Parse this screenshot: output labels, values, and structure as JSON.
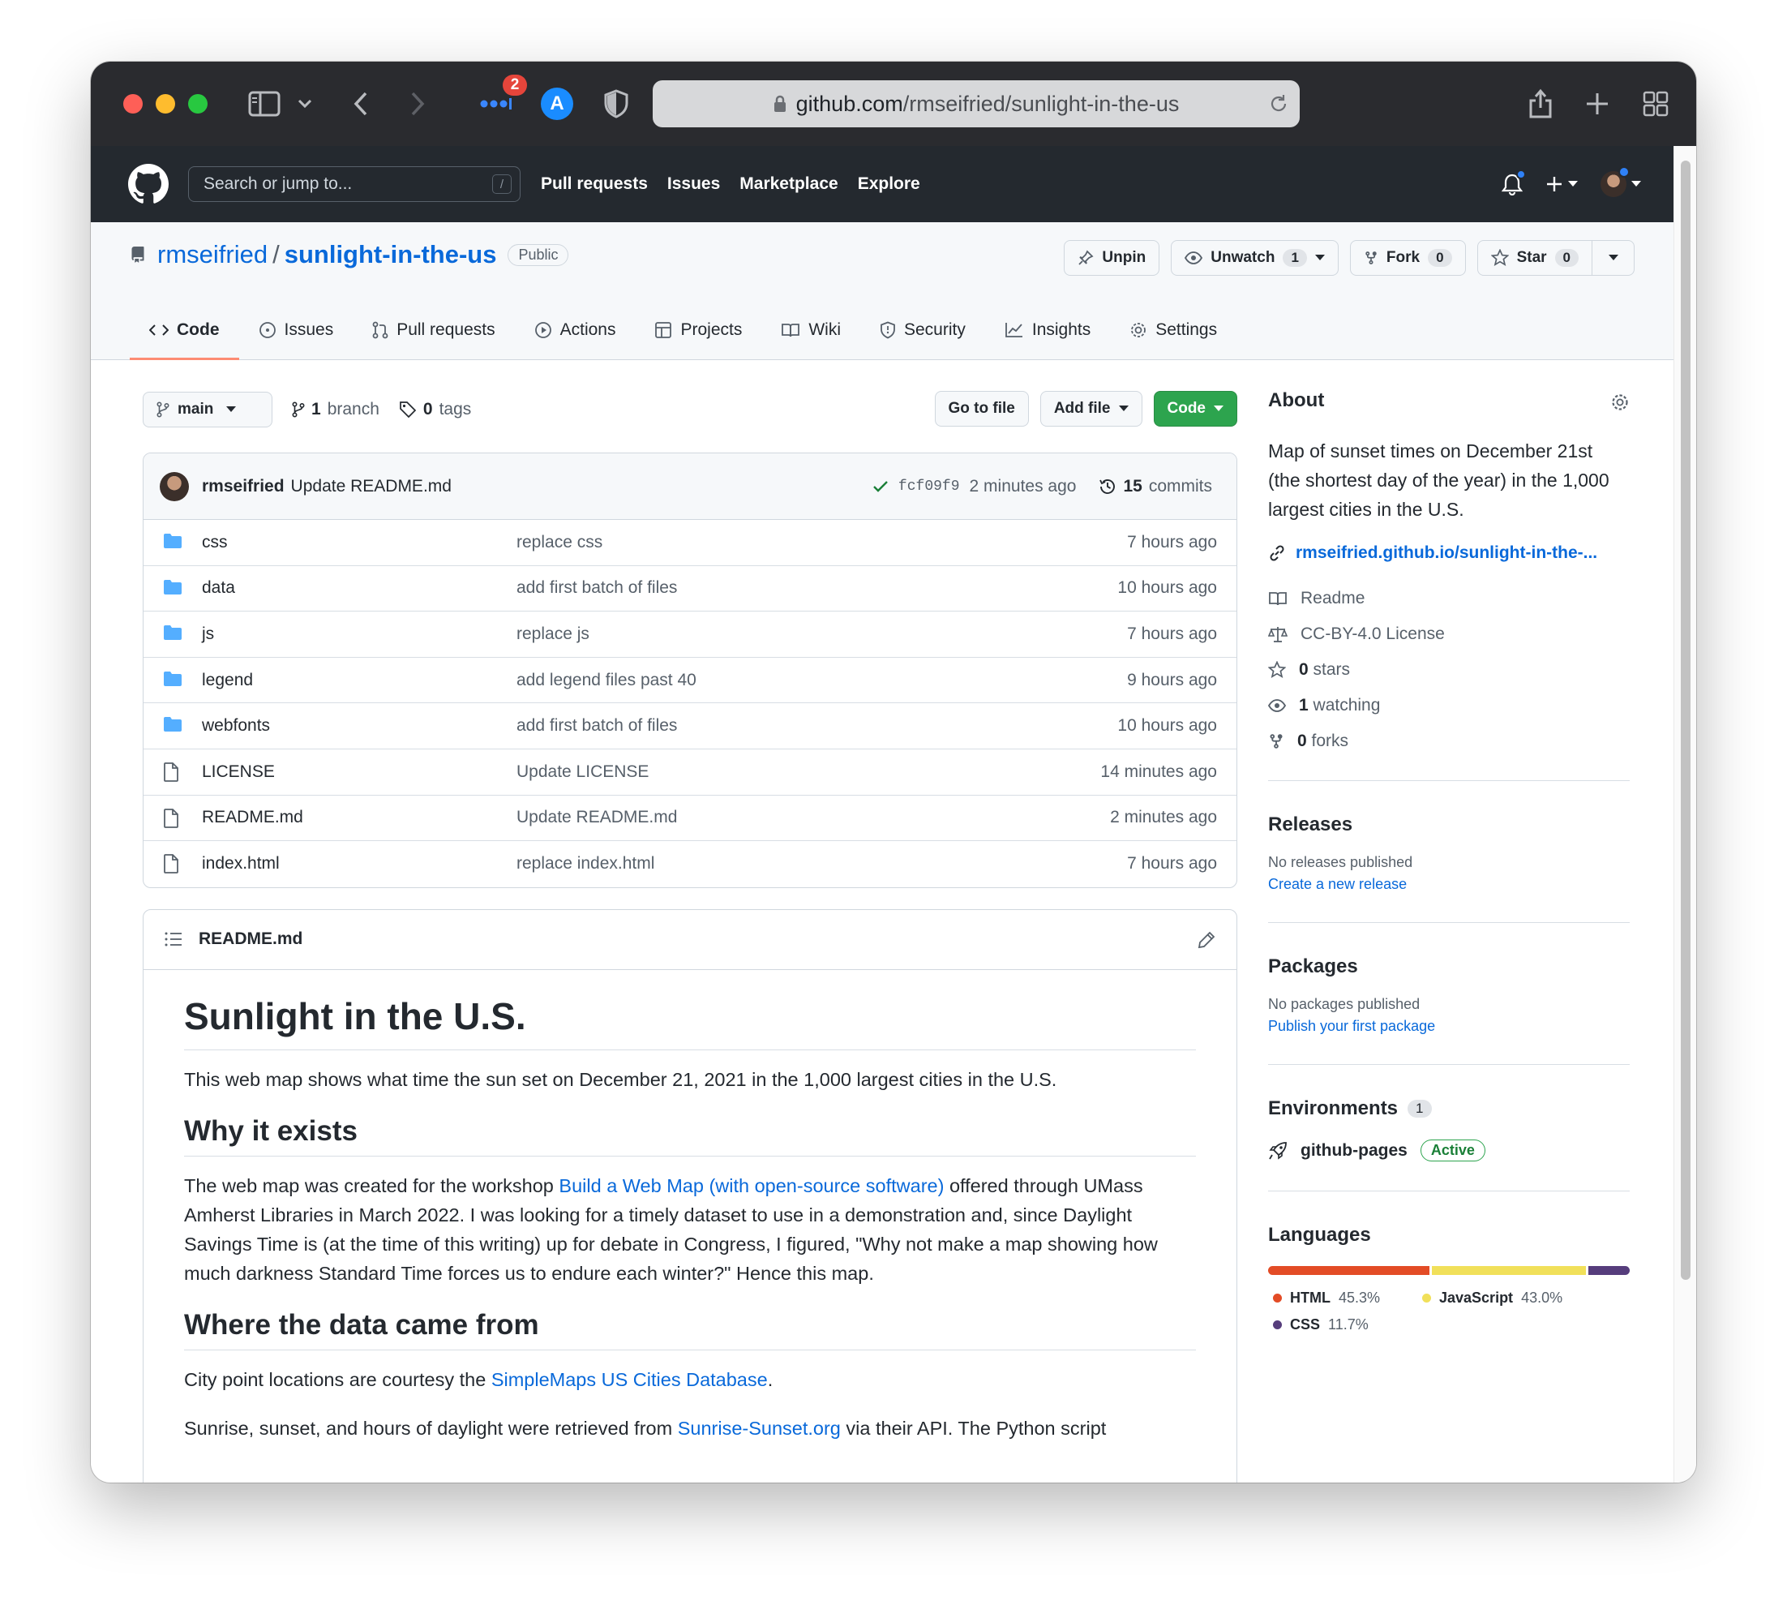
{
  "browser": {
    "url_host": "github.com",
    "url_path": "/rmseifried/sunlight-in-the-us",
    "notification_count": "2",
    "extension_letter": "A"
  },
  "gh_header": {
    "search_placeholder": "Search or jump to...",
    "search_shortcut": "/",
    "nav": [
      "Pull requests",
      "Issues",
      "Marketplace",
      "Explore"
    ]
  },
  "repo": {
    "owner": "rmseifried",
    "separator": "/",
    "name": "sunlight-in-the-us",
    "visibility": "Public",
    "actions": {
      "unpin": "Unpin",
      "unwatch": "Unwatch",
      "watch_count": "1",
      "fork": "Fork",
      "fork_count": "0",
      "star": "Star",
      "star_count": "0"
    },
    "tabs": [
      "Code",
      "Issues",
      "Pull requests",
      "Actions",
      "Projects",
      "Wiki",
      "Security",
      "Insights",
      "Settings"
    ]
  },
  "toolbar": {
    "branch": "main",
    "branch_count": "1",
    "branch_label": "branch",
    "tag_count": "0",
    "tag_label": "tags",
    "go_to_file": "Go to file",
    "add_file": "Add file",
    "code": "Code"
  },
  "commit": {
    "author": "rmseifried",
    "message": "Update README.md",
    "sha": "fcf09f9",
    "time": "2 minutes ago",
    "count": "15",
    "count_label": "commits"
  },
  "files": [
    {
      "name": "css",
      "type": "dir",
      "message": "replace css",
      "age": "7 hours ago"
    },
    {
      "name": "data",
      "type": "dir",
      "message": "add first batch of files",
      "age": "10 hours ago"
    },
    {
      "name": "js",
      "type": "dir",
      "message": "replace js",
      "age": "7 hours ago"
    },
    {
      "name": "legend",
      "type": "dir",
      "message": "add legend files past 40",
      "age": "9 hours ago"
    },
    {
      "name": "webfonts",
      "type": "dir",
      "message": "add first batch of files",
      "age": "10 hours ago"
    },
    {
      "name": "LICENSE",
      "type": "file",
      "message": "Update LICENSE",
      "age": "14 minutes ago"
    },
    {
      "name": "README.md",
      "type": "file",
      "message": "Update README.md",
      "age": "2 minutes ago"
    },
    {
      "name": "index.html",
      "type": "file",
      "message": "replace index.html",
      "age": "7 hours ago"
    }
  ],
  "readme": {
    "filename": "README.md",
    "h1": "Sunlight in the U.S.",
    "intro": "This web map shows what time the sun set on December 21, 2021 in the 1,000 largest cities in the U.S.",
    "h2_why": "Why it exists",
    "why_pre": "The web map was created for the workshop ",
    "why_link": "Build a Web Map (with open-source software)",
    "why_post": " offered through UMass Amherst Libraries in March 2022. I was looking for a timely dataset to use in a demonstration and, since Daylight Savings Time is (at the time of this writing) up for debate in Congress, I figured, \"Why not make a map showing how much darkness Standard Time forces us to endure each winter?\" Hence this map.",
    "h2_data": "Where the data came from",
    "data_pre": "City point locations are courtesy the ",
    "data_link": "SimpleMaps US Cities Database",
    "data_post": ".",
    "sun_pre": "Sunrise, sunset, and hours of daylight were retrieved from ",
    "sun_link": "Sunrise-Sunset.org",
    "sun_post": " via their API. The Python script"
  },
  "sidebar": {
    "about_title": "About",
    "description": "Map of sunset times on December 21st (the shortest day of the year) in the 1,000 largest cities in the U.S.",
    "website": "rmseifried.github.io/sunlight-in-the-...",
    "readme": "Readme",
    "license": "CC-BY-4.0 License",
    "stars_count": "0",
    "stars_label": "stars",
    "watching_count": "1",
    "watching_label": "watching",
    "forks_count": "0",
    "forks_label": "forks",
    "releases_title": "Releases",
    "releases_none": "No releases published",
    "releases_link": "Create a new release",
    "packages_title": "Packages",
    "packages_none": "No packages published",
    "packages_link": "Publish your first package",
    "env_title": "Environments",
    "env_count": "1",
    "env_name": "github-pages",
    "env_status": "Active",
    "languages_title": "Languages",
    "languages": [
      {
        "name": "HTML",
        "pct": "45.3%",
        "value": 45.3,
        "color": "#e34c26"
      },
      {
        "name": "JavaScript",
        "pct": "43.0%",
        "value": 43.0,
        "color": "#f1e05a"
      },
      {
        "name": "CSS",
        "pct": "11.7%",
        "value": 11.7,
        "color": "#563d7c"
      }
    ]
  },
  "colors": {
    "link": "#0969da",
    "header": "#24292f",
    "green_button": "#2da44e",
    "folder": "#54aeff",
    "active_tab_underline": "#fd8c73"
  }
}
